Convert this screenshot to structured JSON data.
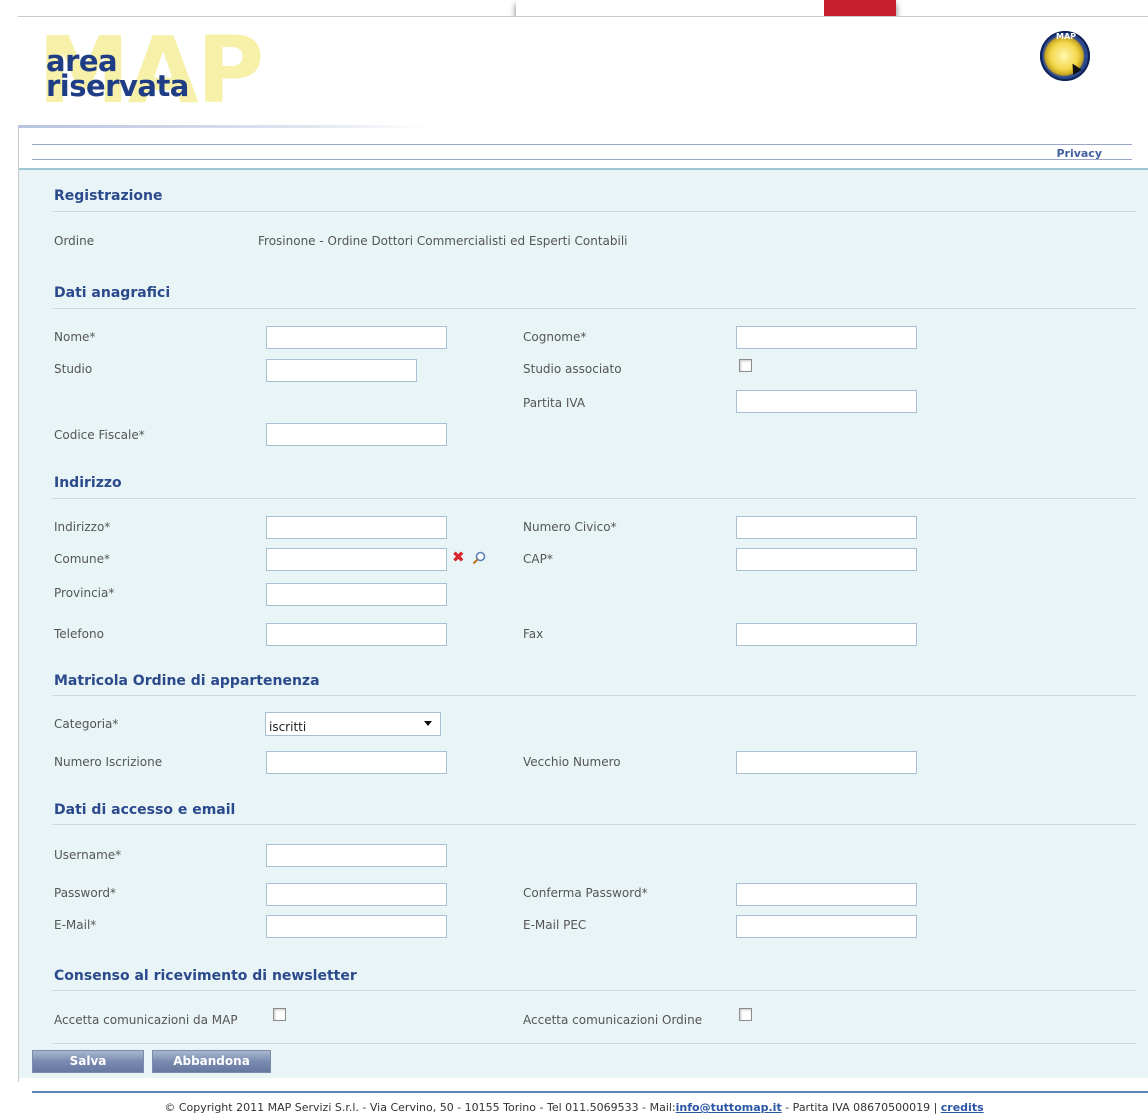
{
  "header": {
    "watermark": "MAP",
    "logo_line1": "area",
    "logo_line2": "riservata",
    "badge_text": "MAP",
    "privacy": "Privacy"
  },
  "form": {
    "title": "Registrazione",
    "ordine_label": "Ordine",
    "ordine_value": "Frosinone - Ordine Dottori Commercialisti ed Esperti Contabili",
    "sections": {
      "anagrafici": "Dati anagrafici",
      "indirizzo": "Indirizzo",
      "matricola": "Matricola Ordine di appartenenza",
      "accesso": "Dati di accesso e email",
      "newsletter": "Consenso al ricevimento di newsletter"
    },
    "labels": {
      "nome": "Nome*",
      "cognome": "Cognome*",
      "studio": "Studio",
      "studio_associato": "Studio associato",
      "partita_iva": "Partita IVA",
      "codice_fiscale": "Codice Fiscale*",
      "indirizzo": "Indirizzo*",
      "numero_civico": "Numero Civico*",
      "comune": "Comune*",
      "cap": "CAP*",
      "provincia": "Provincia*",
      "telefono": "Telefono",
      "fax": "Fax",
      "categoria": "Categoria*",
      "numero_iscrizione": "Numero Iscrizione",
      "vecchio_numero": "Vecchio Numero",
      "username": "Username*",
      "password": "Password*",
      "conferma_password": "Conferma Password*",
      "email": "E-Mail*",
      "email_pec": "E-Mail PEC",
      "accetta_map": "Accetta comunicazioni da MAP",
      "accetta_ordine": "Accetta comunicazioni Ordine"
    },
    "categoria_selected": "iscritti",
    "buttons": {
      "save": "Salva",
      "cancel": "Abbandona"
    }
  },
  "footer": {
    "text_before": "© Copyright 2011 MAP Servizi S.r.l. - Via Cervino, 50 - 10155 Torino - Tel 011.5069533 - Mail:",
    "email": "info@tuttomap.it",
    "text_after": " - Partita IVA 08670500019  |  ",
    "credits": "credits"
  }
}
